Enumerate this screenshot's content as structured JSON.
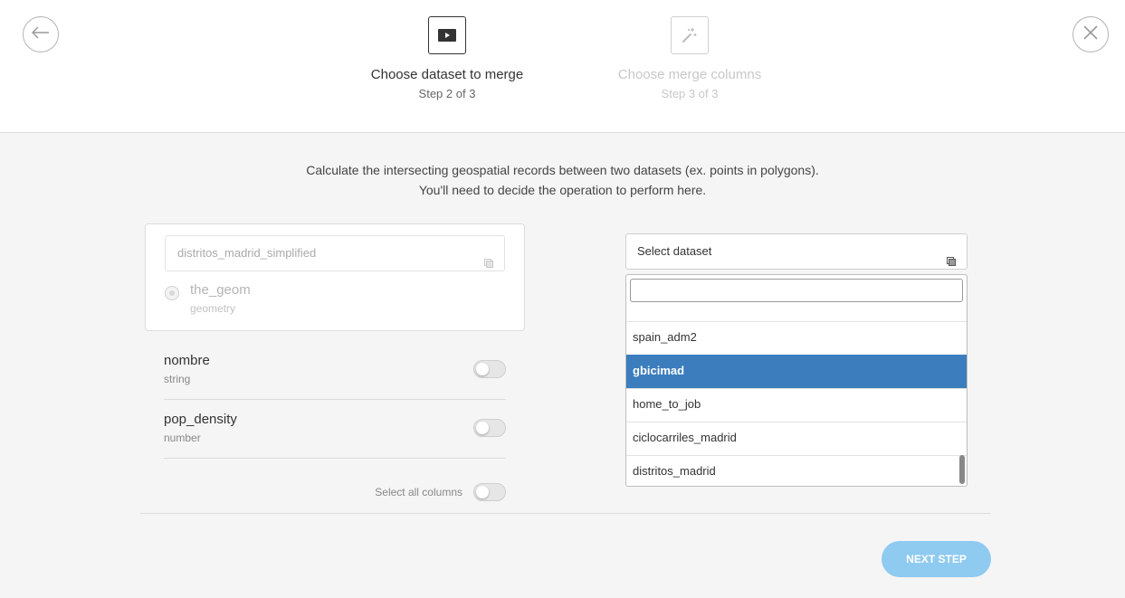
{
  "header": {
    "steps": [
      {
        "title": "Choose dataset to merge",
        "subtitle": "Step 2 of 3",
        "icon": "play-icon",
        "state": "active"
      },
      {
        "title": "Choose merge columns",
        "subtitle": "Step 3 of 3",
        "icon": "magic-wand-icon",
        "state": "inactive"
      }
    ],
    "back_icon": "arrow-left-icon",
    "close_icon": "close-icon"
  },
  "description": {
    "line1": "Calculate the intersecting geospatial records between two datasets (ex. points in polygons).",
    "line2": "You'll need to decide the operation to perform here."
  },
  "source": {
    "dataset": "distritos_madrid_simplified",
    "geometry_column": {
      "name": "the_geom",
      "type": "geometry"
    },
    "columns": [
      {
        "name": "nombre",
        "type": "string",
        "enabled": false
      },
      {
        "name": "pop_density",
        "type": "number",
        "enabled": false
      }
    ],
    "select_all_label": "Select all columns"
  },
  "target": {
    "placeholder": "Select dataset",
    "search_value": "",
    "options": [
      "spain_adm2",
      "gbicimad",
      "home_to_job",
      "ciclocarriles_madrid",
      "distritos_madrid"
    ],
    "highlighted": "gbicimad"
  },
  "next_button": {
    "label": "NEXT STEP"
  },
  "colors": {
    "accent": "#3b7dbd",
    "next_button": "#8fcaf0",
    "background": "#f5f5f5"
  }
}
